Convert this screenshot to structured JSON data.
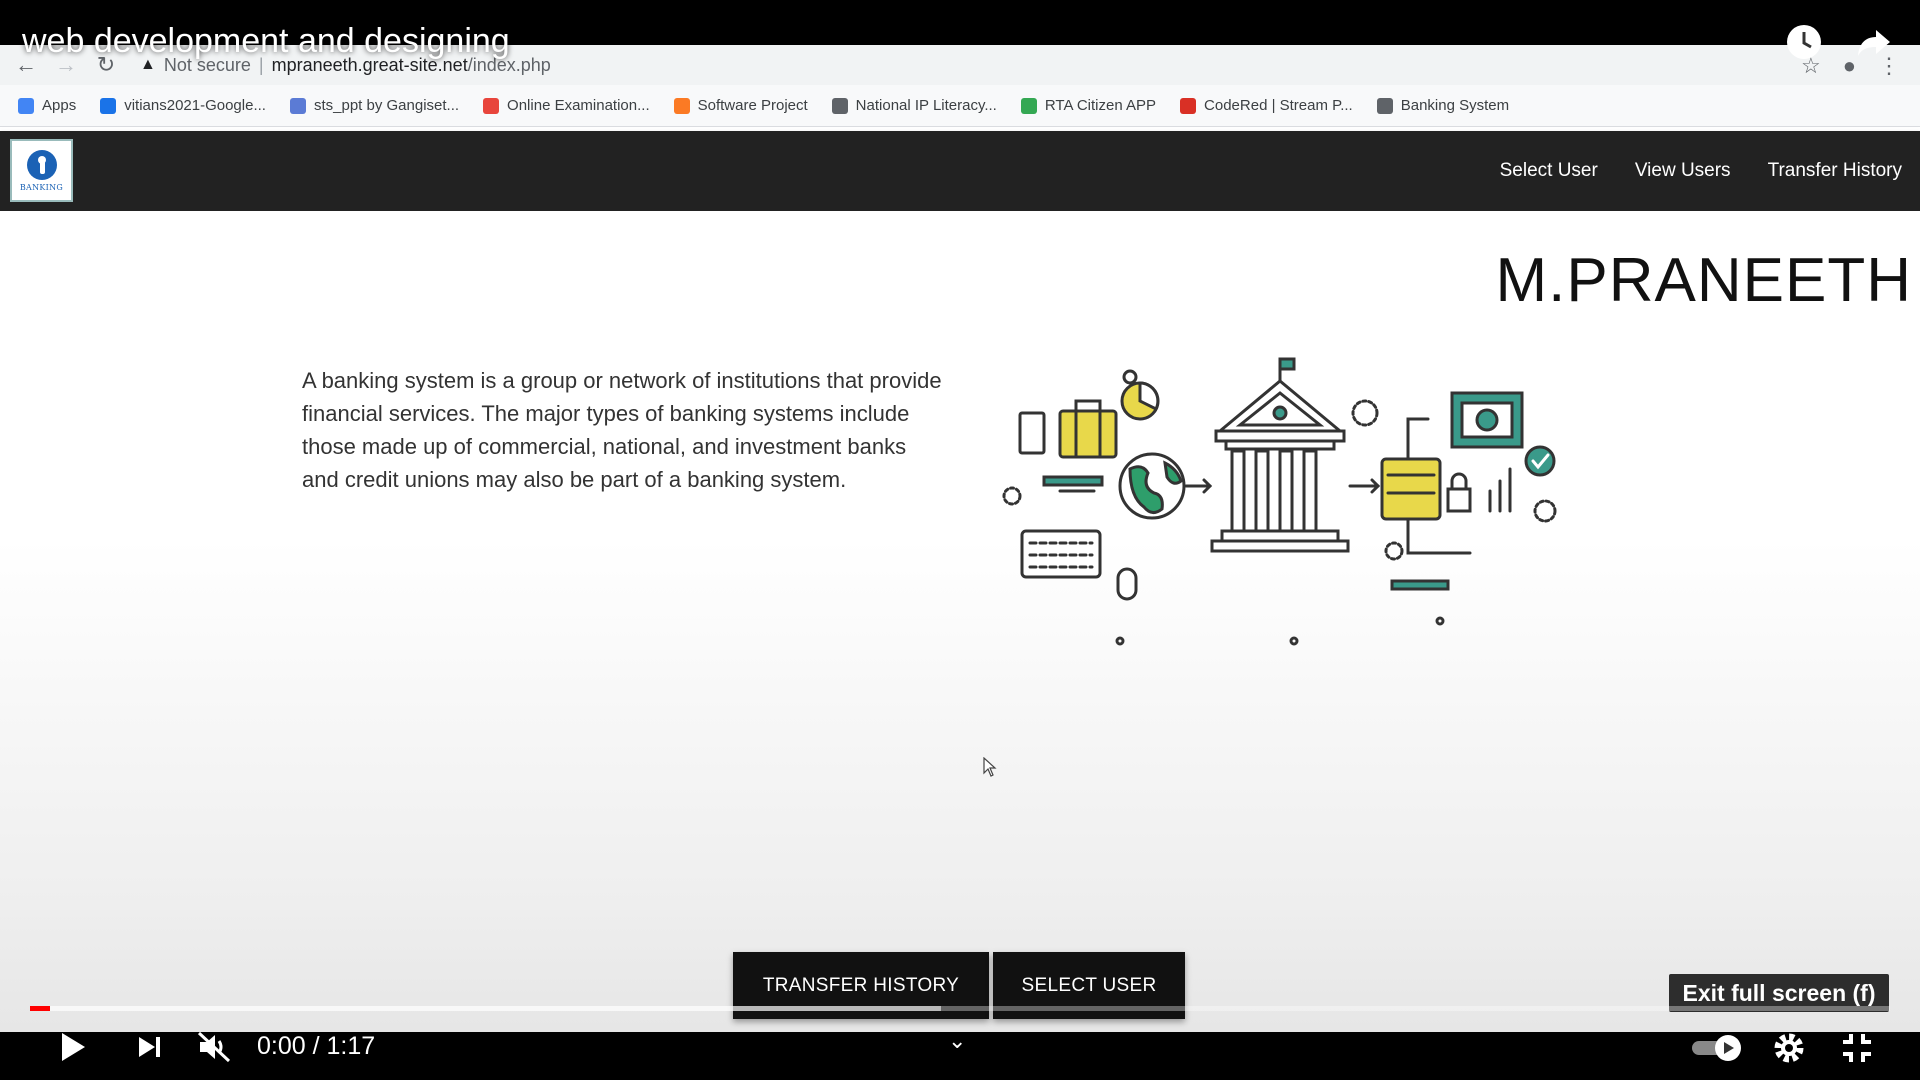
{
  "video": {
    "title": "web development and designing",
    "tooltip": "Exit full screen (f)",
    "time_current": "0:00",
    "time_separator": " / ",
    "time_total": "1:17",
    "progress_played": 0.011,
    "progress_loaded": 0.49
  },
  "browser": {
    "security_label": "Not secure",
    "url_host": "mpraneeth.great-site.net",
    "url_path": "/index.php",
    "bookmarks": [
      {
        "label": "Apps",
        "icon": "apps-grid-icon",
        "color": "#4285f4"
      },
      {
        "label": "vitians2021-Google...",
        "icon": "google-chat-icon",
        "color": "#1a73e8"
      },
      {
        "label": "sts_ppt by Gangiset...",
        "icon": "circle-icon",
        "color": "#5b7bd5"
      },
      {
        "label": "Online Examination...",
        "icon": "site-icon",
        "color": "#e8453c"
      },
      {
        "label": "Software Project",
        "icon": "xampp-icon",
        "color": "#fb7a24"
      },
      {
        "label": "National IP Literacy...",
        "icon": "globe-icon",
        "color": "#5f6368"
      },
      {
        "label": "RTA Citizen APP",
        "icon": "rta-icon",
        "color": "#34a853"
      },
      {
        "label": "CodeRed | Stream P...",
        "icon": "codered-icon",
        "color": "#d93025"
      },
      {
        "label": "Banking System",
        "icon": "globe-icon",
        "color": "#5f6368"
      }
    ]
  },
  "site": {
    "logo_text": "BANKING",
    "nav": [
      "Select User",
      "View Users",
      "Transfer History"
    ],
    "owner_name": "M.PRANEETH",
    "description": "A banking system is a group or network of institutions that provide financial services. The major types of banking systems include those made up of commercial, national, and investment banks and credit unions may also be part of a banking system.",
    "buttons": {
      "transfer_history": "TRANSFER HISTORY",
      "select_user": "SELECT USER"
    }
  },
  "colors": {
    "site_nav_bg": "#222222",
    "progress_red": "#ff0000",
    "illus_green": "#2e9e6b",
    "illus_yellow": "#e8d84a",
    "illus_teal": "#3a9a8a"
  }
}
